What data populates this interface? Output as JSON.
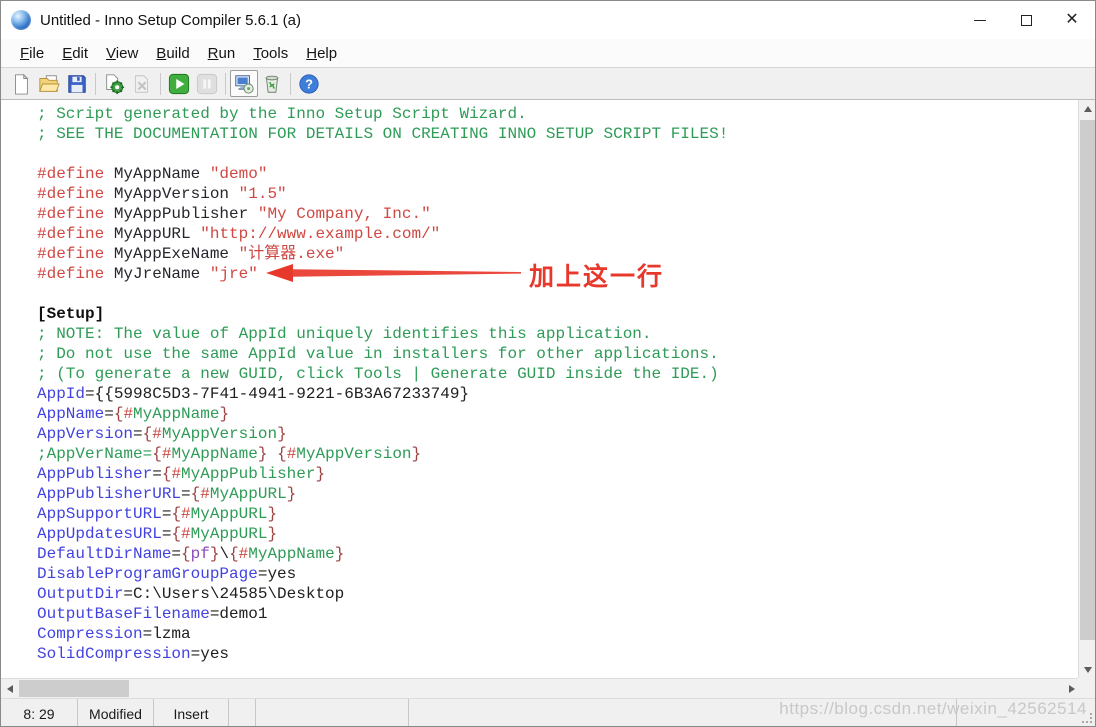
{
  "window": {
    "title": "Untitled - Inno Setup Compiler 5.6.1 (a)"
  },
  "menu": {
    "items": [
      "File",
      "Edit",
      "View",
      "Build",
      "Run",
      "Tools",
      "Help"
    ]
  },
  "toolbar": {
    "icons": [
      "new-file-icon",
      "open-file-icon",
      "save-icon",
      "compile-icon",
      "stop-compile-icon",
      "run-icon",
      "pause-icon",
      "target-setup-icon",
      "target-uninstall-icon",
      "help-icon"
    ]
  },
  "editor": {
    "lines": [
      [
        [
          "c",
          "; Script generated by the Inno Setup Script Wizard."
        ]
      ],
      [
        [
          "c",
          "; SEE THE DOCUMENTATION FOR DETAILS ON CREATING INNO SETUP SCRIPT FILES!"
        ]
      ],
      [],
      [
        [
          "r",
          "#define "
        ],
        [
          "id",
          "MyAppName "
        ],
        [
          "s",
          "\"demo\""
        ]
      ],
      [
        [
          "r",
          "#define "
        ],
        [
          "id",
          "MyAppVersion "
        ],
        [
          "s",
          "\"1.5\""
        ]
      ],
      [
        [
          "r",
          "#define "
        ],
        [
          "id",
          "MyAppPublisher "
        ],
        [
          "s",
          "\"My Company, Inc.\""
        ]
      ],
      [
        [
          "r",
          "#define "
        ],
        [
          "id",
          "MyAppURL "
        ],
        [
          "s",
          "\"http://www.example.com/\""
        ]
      ],
      [
        [
          "r",
          "#define "
        ],
        [
          "id",
          "MyAppExeName "
        ],
        [
          "s",
          "\"计算器.exe\""
        ]
      ],
      [
        [
          "r",
          "#define "
        ],
        [
          "id",
          "MyJreName "
        ],
        [
          "s",
          "\"jre\""
        ]
      ],
      [],
      [
        [
          "sec",
          "[Setup]"
        ]
      ],
      [
        [
          "c",
          "; NOTE: The value of AppId uniquely identifies this application."
        ]
      ],
      [
        [
          "c",
          "; Do not use the same AppId value in installers for other applications."
        ]
      ],
      [
        [
          "c",
          "; (To generate a new GUID, click Tools | Generate GUID inside the IDE.)"
        ]
      ],
      [
        [
          "k",
          "AppId"
        ],
        [
          "t",
          "={{5998C5D3-7F41-4941-9221-6B3A67233749}"
        ]
      ],
      [
        [
          "k",
          "AppName"
        ],
        [
          "t",
          "="
        ],
        [
          "b",
          "{"
        ],
        [
          "r",
          "#"
        ],
        [
          "c",
          "MyAppName"
        ],
        [
          "b",
          "}"
        ]
      ],
      [
        [
          "k",
          "AppVersion"
        ],
        [
          "t",
          "="
        ],
        [
          "b",
          "{"
        ],
        [
          "r",
          "#"
        ],
        [
          "c",
          "MyAppVersion"
        ],
        [
          "b",
          "}"
        ]
      ],
      [
        [
          "c",
          ";AppVerName="
        ],
        [
          "b",
          "{"
        ],
        [
          "r",
          "#"
        ],
        [
          "c",
          "MyAppName"
        ],
        [
          "b",
          "}"
        ],
        [
          "t",
          " "
        ],
        [
          "b",
          "{"
        ],
        [
          "r",
          "#"
        ],
        [
          "c",
          "MyAppVersion"
        ],
        [
          "b",
          "}"
        ]
      ],
      [
        [
          "k",
          "AppPublisher"
        ],
        [
          "t",
          "="
        ],
        [
          "b",
          "{"
        ],
        [
          "r",
          "#"
        ],
        [
          "c",
          "MyAppPublisher"
        ],
        [
          "b",
          "}"
        ]
      ],
      [
        [
          "k",
          "AppPublisherURL"
        ],
        [
          "t",
          "="
        ],
        [
          "b",
          "{"
        ],
        [
          "r",
          "#"
        ],
        [
          "c",
          "MyAppURL"
        ],
        [
          "b",
          "}"
        ]
      ],
      [
        [
          "k",
          "AppSupportURL"
        ],
        [
          "t",
          "="
        ],
        [
          "b",
          "{"
        ],
        [
          "r",
          "#"
        ],
        [
          "c",
          "MyAppURL"
        ],
        [
          "b",
          "}"
        ]
      ],
      [
        [
          "k",
          "AppUpdatesURL"
        ],
        [
          "t",
          "="
        ],
        [
          "b",
          "{"
        ],
        [
          "r",
          "#"
        ],
        [
          "c",
          "MyAppURL"
        ],
        [
          "b",
          "}"
        ]
      ],
      [
        [
          "k",
          "DefaultDirName"
        ],
        [
          "t",
          "="
        ],
        [
          "b",
          "{"
        ],
        [
          "p",
          "pf"
        ],
        [
          "b",
          "}"
        ],
        [
          "t",
          "\\"
        ],
        [
          "b",
          "{"
        ],
        [
          "r",
          "#"
        ],
        [
          "c",
          "MyAppName"
        ],
        [
          "b",
          "}"
        ]
      ],
      [
        [
          "k",
          "DisableProgramGroupPage"
        ],
        [
          "t",
          "=yes"
        ]
      ],
      [
        [
          "k",
          "OutputDir"
        ],
        [
          "t",
          "=C:\\Users\\24585\\Desktop"
        ]
      ],
      [
        [
          "k",
          "OutputBaseFilename"
        ],
        [
          "t",
          "=demo1"
        ]
      ],
      [
        [
          "k",
          "Compression"
        ],
        [
          "t",
          "=lzma"
        ]
      ],
      [
        [
          "k",
          "SolidCompression"
        ],
        [
          "t",
          "=yes"
        ]
      ]
    ]
  },
  "annotation": {
    "text": "加上这一行"
  },
  "statusbar": {
    "line_col": "8: 29",
    "modified": "Modified",
    "insert_mode": "Insert"
  },
  "watermark": "https://blog.csdn.net/weixin_42562514",
  "colors": {
    "comment": "#2e9b57",
    "keyword": "#4242e0",
    "directive": "#cf4843",
    "brace": "#9c4343",
    "constant": "#8a4bbf",
    "annotation": "#e8382c"
  }
}
